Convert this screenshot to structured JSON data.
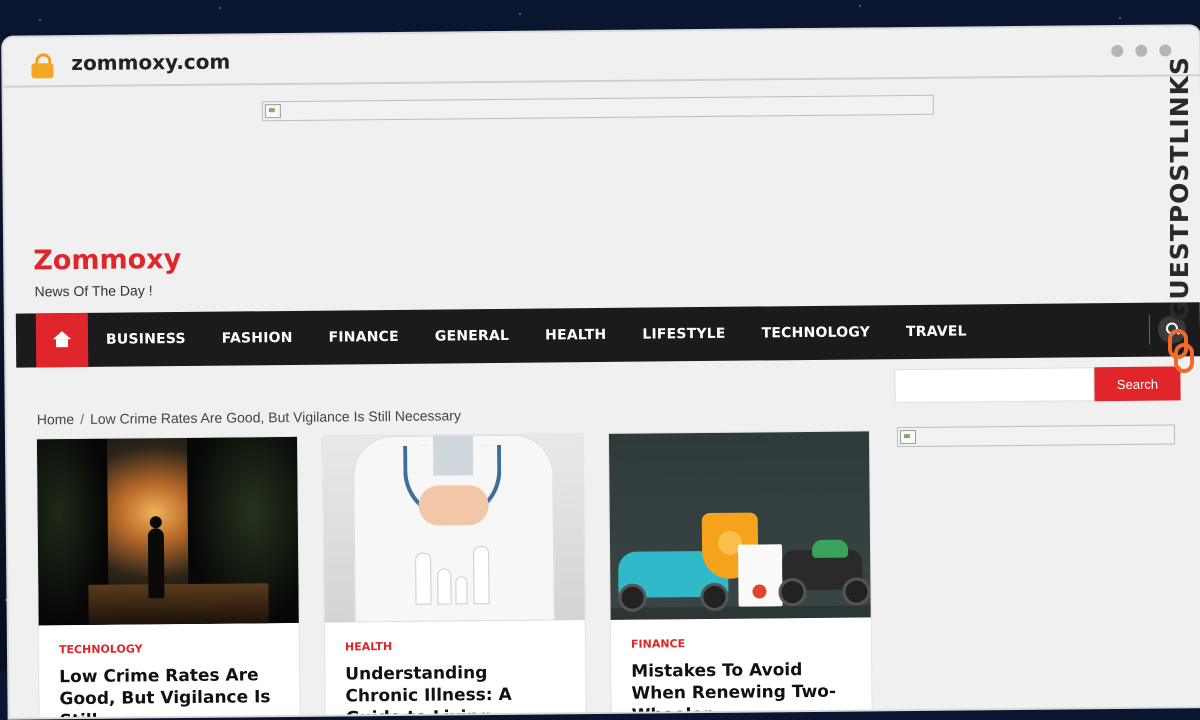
{
  "browser": {
    "url": "zommoxy.com",
    "lock_icon": "lock-icon"
  },
  "site": {
    "title": "Zommoxy",
    "tagline": "News Of The Day !",
    "accent_color": "#e0262b"
  },
  "nav": {
    "home_icon": "home-icon",
    "items": [
      "BUSINESS",
      "FASHION",
      "FINANCE",
      "GENERAL",
      "HEALTH",
      "LIFESTYLE",
      "TECHNOLOGY",
      "TRAVEL"
    ],
    "search_icon": "search-icon"
  },
  "breadcrumb": {
    "home": "Home",
    "current": "Low Crime Rates Are Good, But Vigilance Is Still Necessary"
  },
  "cards": [
    {
      "category": "TECHNOLOGY",
      "title": "Low Crime Rates Are Good, But Vigilance Is Still"
    },
    {
      "category": "HEALTH",
      "title": "Understanding Chronic Illness: A Guide to Living"
    },
    {
      "category": "FINANCE",
      "title": "Mistakes To Avoid When Renewing Two-Wheeler"
    }
  ],
  "sidebar": {
    "search_button": "Search"
  },
  "watermark": {
    "text": "GUESTPOSTLINKS"
  }
}
